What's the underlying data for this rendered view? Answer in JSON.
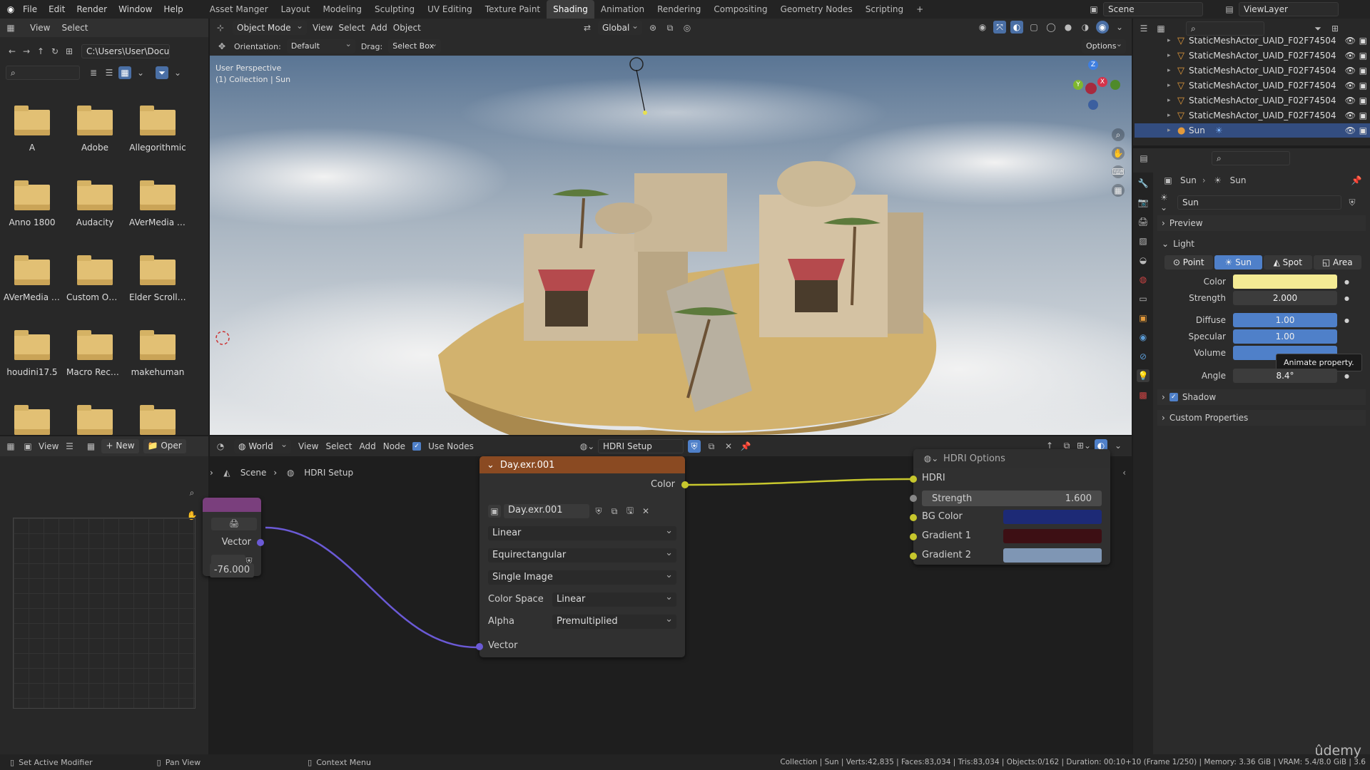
{
  "menubar": {
    "items": [
      "File",
      "Edit",
      "Render",
      "Window",
      "Help"
    ],
    "workspaces": [
      "Asset Manger",
      "Layout",
      "Modeling",
      "Sculpting",
      "UV Editing",
      "Texture Paint",
      "Shading",
      "Animation",
      "Rendering",
      "Compositing",
      "Geometry Nodes",
      "Scripting"
    ],
    "active_workspace": "Shading",
    "add_tab": "+",
    "scene": "Scene",
    "view_layer": "ViewLayer"
  },
  "file_browser": {
    "menu": [
      "View",
      "Select"
    ],
    "path": "C:\\Users\\User\\Docu...",
    "folders": [
      "A",
      "Adobe",
      "Allegorithmic",
      "Anno 1800",
      "Audacity",
      "AVerMedia A...",
      "AVerMedia C...",
      "Custom Offic...",
      "Elder Scrolls ...",
      "houdini17.5",
      "Macro Recor...",
      "makehuman",
      "",
      "",
      " "
    ]
  },
  "viewport": {
    "mode": "Object Mode",
    "menu": [
      "View",
      "Select",
      "Add",
      "Object"
    ],
    "transform": "Global",
    "orientation_label": "Orientation:",
    "orientation": "Default",
    "drag_label": "Drag:",
    "drag": "Select Box",
    "options": "Options",
    "overlay_title": "User Perspective",
    "overlay_sub": "(1) Collection | Sun",
    "gizmo": {
      "x": "X",
      "y": "Y",
      "z": "Z"
    }
  },
  "image_editor": {
    "view": "View",
    "new": "New",
    "open": "Oper"
  },
  "node_editor": {
    "world_type": "World",
    "menu": [
      "View",
      "Select",
      "Add",
      "Node"
    ],
    "use_nodes": "Use Nodes",
    "world_name": "HDRI Setup",
    "breadcrumb": [
      "Scene",
      "HDRI Setup"
    ],
    "left_node": {
      "output": "Vector",
      "value": "-76.000"
    },
    "image_node": {
      "title": "Day.exr.001",
      "output": "Color",
      "image_name": "Day.exr.001",
      "interpolation": "Linear",
      "projection": "Equirectangular",
      "source": "Single Image",
      "color_space_label": "Color Space",
      "color_space": "Linear",
      "alpha_label": "Alpha",
      "alpha": "Premultiplied",
      "input": "Vector"
    },
    "hdri_node": {
      "title": "HDRI Options",
      "hdri": "HDRI",
      "strength_label": "Strength",
      "strength": "1.600",
      "bg_color": "BG Color",
      "gradient1": "Gradient 1",
      "gradient2": "Gradient 2"
    }
  },
  "outliner": {
    "rows": [
      "StaticMeshActor_UAID_F02F74504",
      "StaticMeshActor_UAID_F02F74504",
      "StaticMeshActor_UAID_F02F74504",
      "StaticMeshActor_UAID_F02F74504",
      "StaticMeshActor_UAID_F02F74504",
      "StaticMeshActor_UAID_F02F74504"
    ],
    "selected": "Sun"
  },
  "properties": {
    "breadcrumb": [
      "Sun",
      "Sun"
    ],
    "datablock": "Sun",
    "panels": {
      "preview": "Preview",
      "light": "Light",
      "shadow": "Shadow",
      "custom": "Custom Properties"
    },
    "light_types": [
      "Point",
      "Sun",
      "Spot",
      "Area"
    ],
    "active_light_type": "Sun",
    "color_label": "Color",
    "strength_label": "Strength",
    "strength": "2.000",
    "diffuse_label": "Diffuse",
    "diffuse": "1.00",
    "specular_label": "Specular",
    "specular": "1.00",
    "volume_label": "Volume",
    "angle_label": "Angle",
    "angle": "8.4°",
    "tooltip": "Animate property."
  },
  "statusbar": {
    "left": [
      "Set Active Modifier",
      "Pan View",
      "Context Menu"
    ],
    "stats": "Collection | Sun | Verts:42,835 | Faces:83,034 | Tris:83,034 | Objects:0/162 | Duration: 00:10+10 (Frame 1/250) | Memory: 3.36 GiB | VRAM: 5.4/8.0 GiB | 3.6",
    "watermark": "ûdemy"
  },
  "colors": {
    "light_color": "#f4eb94",
    "blue_field": "#4f80c9",
    "bg_color": "#1d2a76",
    "gradient1": "#3d0f14",
    "gradient2": "#7f96b4",
    "image_node_header": "#8a4a22"
  }
}
